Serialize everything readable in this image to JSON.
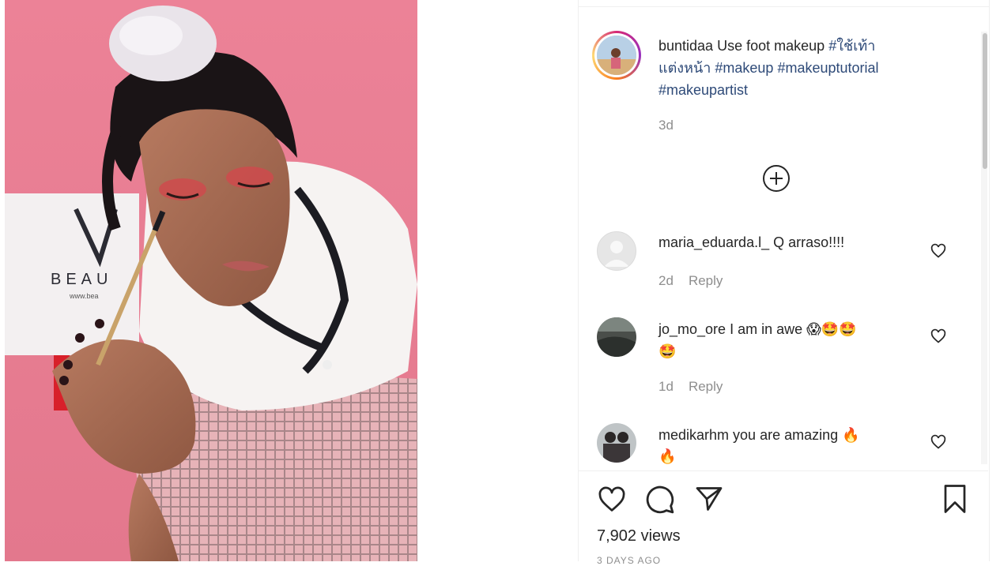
{
  "media": {
    "bag_brand": "BEAU",
    "bag_sub": "www.bea"
  },
  "caption": {
    "username": "buntidaa",
    "text": "Use foot makeup",
    "hashtags": [
      "#ใช้เท้า",
      "แต่งหน้า",
      "#makeup",
      "#makeuptutorial",
      "#makeupartist"
    ],
    "time": "3d"
  },
  "load_more_icon": "plus-circle-icon",
  "comments": [
    {
      "username": "maria_eduarda.l_",
      "text": "Q arraso!!!!",
      "line2": "",
      "time": "2d",
      "reply_label": "Reply",
      "avatar": "default-avatar"
    },
    {
      "username": "jo_mo_ore",
      "text": "I am in awe 😱🤩🤩",
      "line2": "🤩",
      "time": "1d",
      "reply_label": "Reply",
      "avatar": "photo-avatar"
    },
    {
      "username": "medikarhm",
      "text": "you are amazing 🔥",
      "line2": "🔥",
      "time": "",
      "reply_label": "",
      "avatar": "photo-avatar"
    }
  ],
  "actions": {
    "like_icon": "heart-icon",
    "comment_icon": "comment-icon",
    "share_icon": "paper-plane-icon",
    "save_icon": "bookmark-icon"
  },
  "views": "7,902 views",
  "posted_date": "3 DAYS AGO",
  "colors": {
    "background_pink": "#e97f93",
    "hashtag_blue": "#2e4a78",
    "muted_gray": "#8e8e8e"
  }
}
